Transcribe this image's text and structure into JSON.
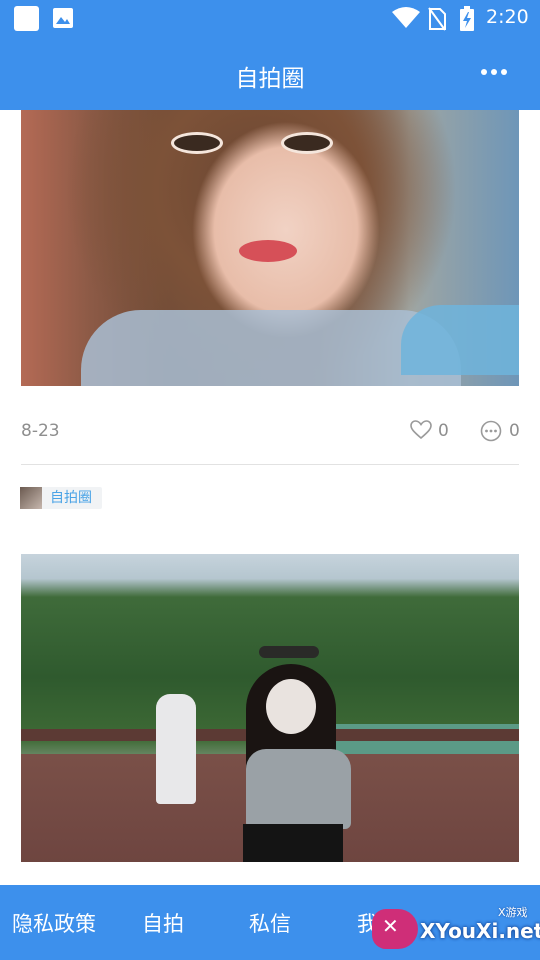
{
  "status_bar": {
    "time": "2:20",
    "icons": [
      "app-square-icon",
      "image-icon",
      "wifi-icon",
      "no-sim-icon",
      "battery-charging-icon"
    ]
  },
  "app_bar": {
    "title": "自拍圈",
    "menu_icon": "more-horizontal-icon"
  },
  "feed": {
    "post1": {
      "date": "8-23",
      "likes": "0",
      "comments": "0"
    },
    "post2": {
      "tag": "自拍圈"
    }
  },
  "bottom_nav": {
    "items": [
      {
        "label": "隐私政策"
      },
      {
        "label": "自拍"
      },
      {
        "label": "私信"
      },
      {
        "label": "我"
      }
    ]
  },
  "watermark": {
    "brand": "XYouXi.net",
    "sub": "X游戏"
  },
  "colors": {
    "primary": "#3d90ec",
    "tag_text": "#4aa3e6",
    "meta_text": "#8e8e8e"
  }
}
